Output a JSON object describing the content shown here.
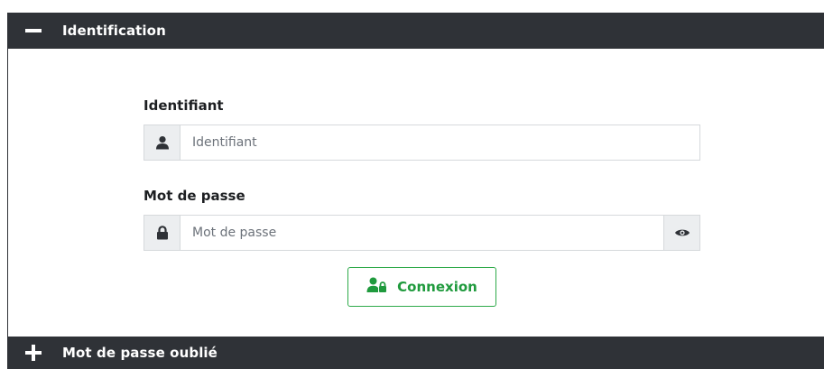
{
  "identification_section": {
    "title": "Identification",
    "toggle_icon": "minus-icon",
    "expanded": true
  },
  "username": {
    "label": "Identifiant",
    "placeholder": "Identifiant",
    "value": "",
    "icon": "user-icon"
  },
  "password": {
    "label": "Mot de passe",
    "placeholder": "Mot de passe",
    "value": "",
    "icon": "lock-icon",
    "toggle_icon": "eye-icon"
  },
  "login_button": {
    "label": "Connexion",
    "icon": "user-lock-icon",
    "color": "#1f9a3d"
  },
  "forgot_section": {
    "title": "Mot de passe oublié",
    "toggle_icon": "plus-icon",
    "expanded": false
  },
  "colors": {
    "header_bg": "#2f3237",
    "addon_bg": "#eceef0",
    "accent_green": "#2eaa4a"
  }
}
